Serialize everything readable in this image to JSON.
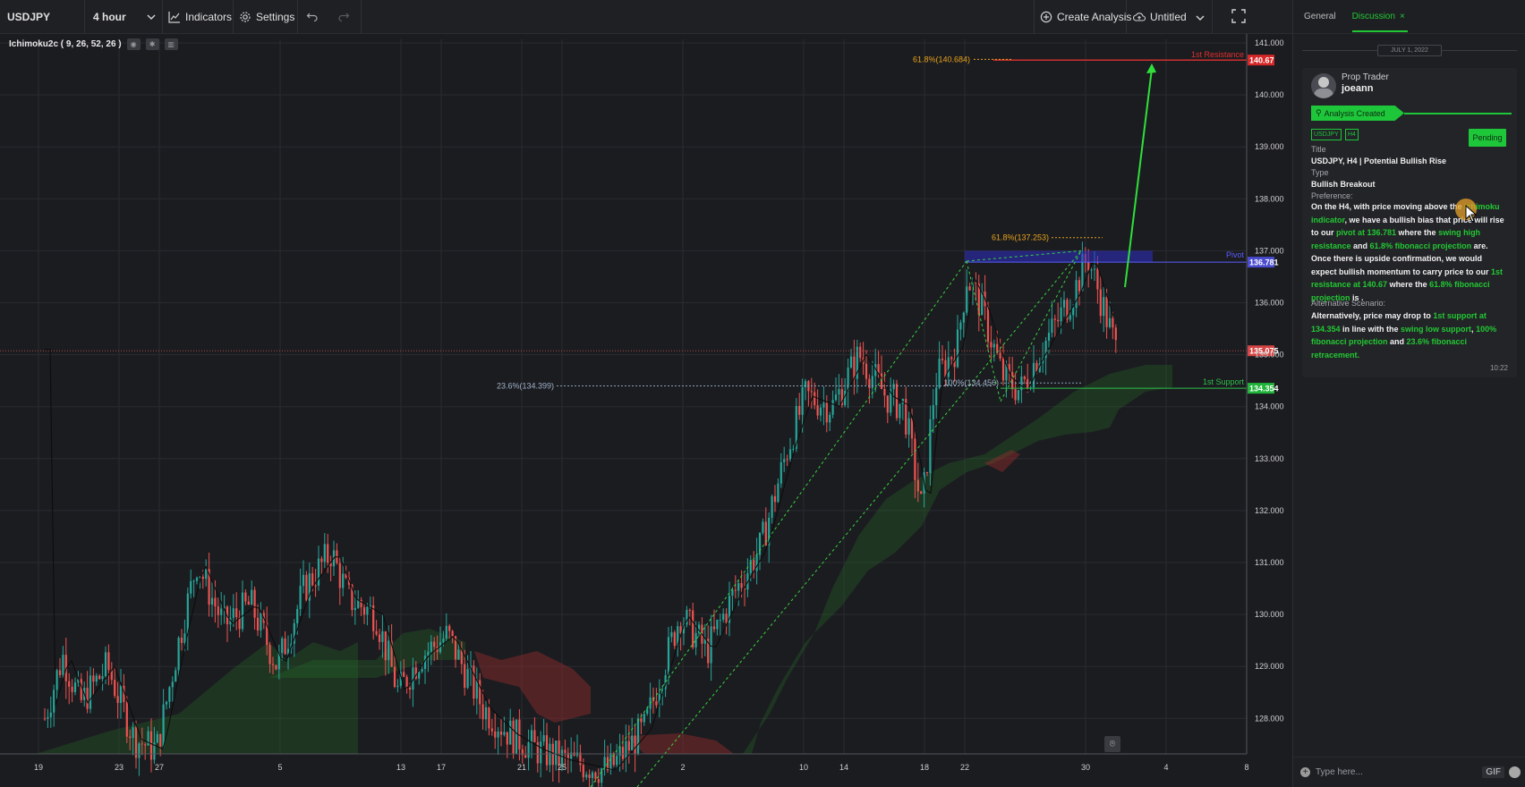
{
  "toolbar": {
    "symbol": "USDJPY",
    "interval": "4 hour",
    "indicators_label": "Indicators",
    "settings_label": "Settings",
    "create_analysis_label": "Create Analysis",
    "layout_name": "Untitled"
  },
  "indicator_label": "Ichimoku2c ( 9, 26, 52, 26 )",
  "sidebar": {
    "tabs": {
      "general": "General",
      "discussion": "Discussion"
    },
    "date_divider": "JULY 1, 2022",
    "post": {
      "author_role": "Prop Trader",
      "author_name": "joeann",
      "status": "Analysis Created",
      "tags": [
        "USDJPY",
        "H4"
      ],
      "state": "Pending",
      "title_label": "Title",
      "title": "USDJPY, H4 | Potential Bullish Rise",
      "type_label": "Type",
      "type": "Bullish Breakout",
      "preference_label": "Preference:",
      "alt_label": "Alternative Scenario:",
      "time": "10:22"
    },
    "composer_placeholder": "Type here...",
    "gif_label": "GIF"
  },
  "colors": {
    "accent_green": "#22c833",
    "bull_candle": "#26a69a",
    "bear_candle": "#ef5350",
    "resistance_red": "#e03030",
    "pivot_blue": "#3a3ddb",
    "fib_orange": "#e8a21b"
  },
  "chart_data": {
    "type": "candlestick",
    "symbol": "USDJPY",
    "timeframe": "4 hour",
    "y_axis_ticks": [
      "141.000",
      "140.000",
      "139.000",
      "138.000",
      "137.000",
      "136.000",
      "135.000",
      "134.000",
      "133.000",
      "132.000",
      "131.000",
      "130.000",
      "129.000",
      "128.000"
    ],
    "ylim": [
      127.3,
      141.2
    ],
    "x_axis_ticks": [
      "19",
      "23",
      "27",
      "5",
      "13",
      "17",
      "21",
      "25",
      "2",
      "10",
      "14",
      "18",
      "22",
      "30",
      "4",
      "8"
    ],
    "price_tags": {
      "resistance": "140.67",
      "pivot": "136.781",
      "current": "135.075",
      "support": "134.354"
    },
    "levels": {
      "resistance": {
        "label": "1st Resistance",
        "price": 140.67
      },
      "pivot": {
        "label": "Pivot",
        "price": 136.781
      },
      "support": {
        "label": "1st Support",
        "price": 134.354
      },
      "current": {
        "price": 135.075
      }
    },
    "fib_labels": {
      "fib_618_upper": "61.8%(140.684)",
      "fib_618_lower": "61.8%(137.253)",
      "fib_236": "23.6%(134.399)",
      "fib_100": "100%(134.456)"
    }
  }
}
